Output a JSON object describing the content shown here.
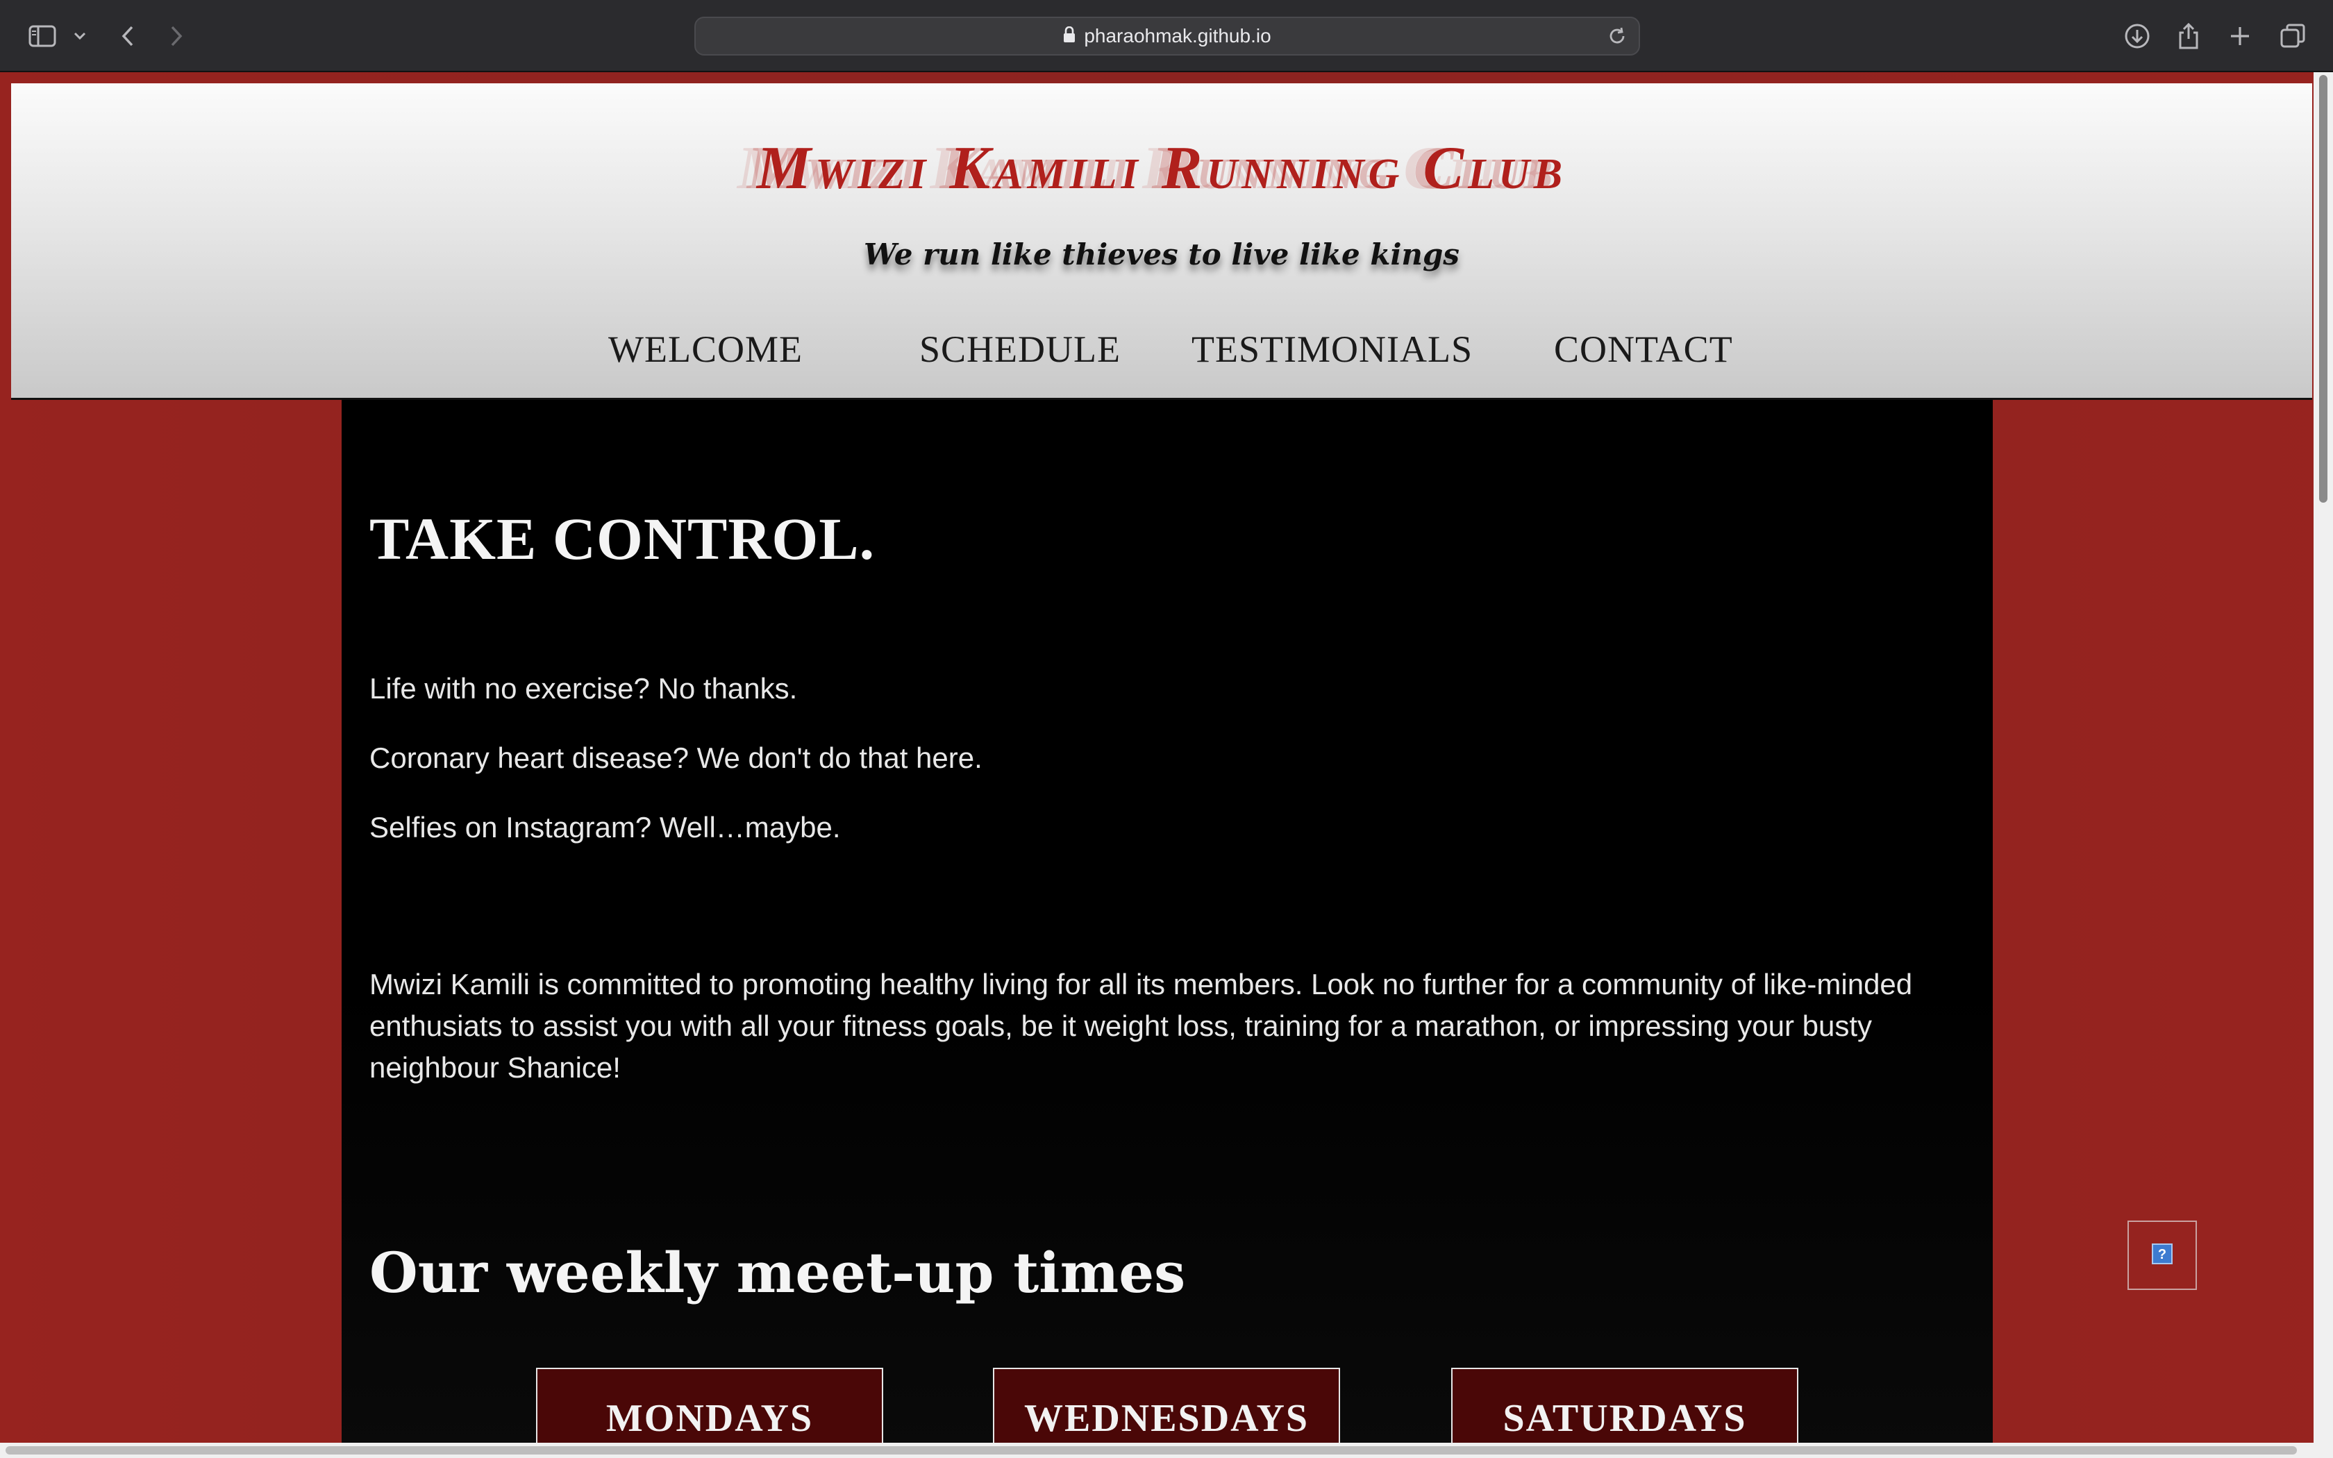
{
  "browser": {
    "url": "pharaohmak.github.io",
    "icons": [
      "sidebar-icon",
      "chevron-down-icon",
      "back-icon",
      "forward-icon",
      "lock-icon",
      "reload-icon",
      "download-icon",
      "share-icon",
      "new-tab-icon",
      "tabs-overview-icon"
    ]
  },
  "site": {
    "title": "Mwizi Kamili Running Club",
    "tagline": "We run like thieves to live like kings",
    "nav": [
      "WELCOME",
      "SCHEDULE",
      "TESTIMONIALS",
      "CONTACT"
    ]
  },
  "main": {
    "heading": "TAKE CONTROL.",
    "lines": [
      "Life with no exercise? No thanks.",
      "Coronary heart disease? We don't do that here.",
      "Selfies on Instagram? Well…maybe."
    ],
    "body": "Mwizi Kamili is committed to promoting healthy living for all its members. Look no further for a community of like-minded enthusiats to assist you with all your fitness goals, be it weight loss, training for a marathon, or impressing your busty neighbour Shanice!",
    "schedule_heading": "Our weekly meet-up times",
    "days": [
      "MONDAYS",
      "WEDNESDAYS",
      "SATURDAYS"
    ]
  },
  "colors": {
    "page_background": "#97231f",
    "title_red": "#b0201c",
    "day_header": "#4a0707",
    "content_background": "#000000"
  }
}
